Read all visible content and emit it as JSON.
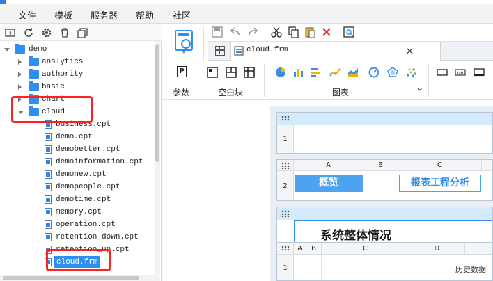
{
  "menubar": {
    "items": [
      "文件",
      "模板",
      "服务器",
      "帮助",
      "社区"
    ]
  },
  "tree": {
    "root": "demo",
    "folders": [
      "analytics",
      "authority",
      "basic",
      "chart",
      "cloud"
    ],
    "files": [
      "business.cpt",
      "demo.cpt",
      "demobetter.cpt",
      "demoinformation.cpt",
      "demonew.cpt",
      "demopeople.cpt",
      "demotime.cpt",
      "memory.cpt",
      "operation.cpt",
      "retention_down.cpt",
      "retention_up.cpt",
      "cloud.frm"
    ],
    "selected": "cloud.frm"
  },
  "tab": {
    "title": "cloud.frm",
    "close": "×"
  },
  "ribbon": {
    "param_label": "参数",
    "param_button": "P",
    "blank_label": "空白块",
    "chart_label": "图表",
    "caret": "⌄"
  },
  "canvas": {
    "panel1": {
      "rows": [
        "1"
      ]
    },
    "panel2": {
      "columns": [
        "A",
        "B",
        "C"
      ],
      "rows": [
        "2"
      ],
      "cell_overview": "概览",
      "cell_analysis": "报表工程分析"
    },
    "panel3": {
      "partial_text": "系统整体情况"
    },
    "panel4": {
      "columns": [
        "A",
        "B",
        "C",
        "D"
      ],
      "rows": [
        "1"
      ],
      "cell_history": "历史数据"
    }
  },
  "colors": {
    "accent": "#2f8ff0",
    "highlight": "#ff2020",
    "title_band": "#d4ebfb"
  }
}
